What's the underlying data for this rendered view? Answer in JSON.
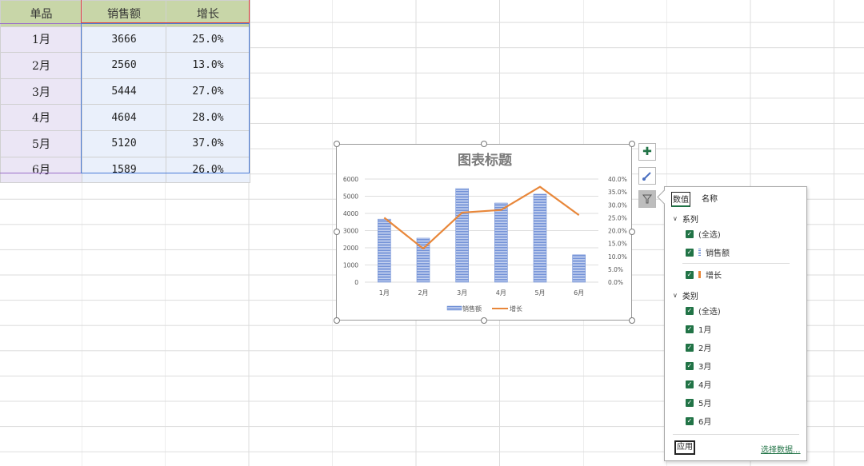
{
  "table": {
    "headers": [
      "单品",
      "销售额",
      "增长"
    ],
    "rows": [
      {
        "month": "1月",
        "sales": "3666",
        "growth": "25.0%"
      },
      {
        "month": "2月",
        "sales": "2560",
        "growth": "13.0%"
      },
      {
        "month": "3月",
        "sales": "5444",
        "growth": "27.0%"
      },
      {
        "month": "4月",
        "sales": "4604",
        "growth": "28.0%"
      },
      {
        "month": "5月",
        "sales": "5120",
        "growth": "37.0%"
      },
      {
        "month": "6月",
        "sales": "1589",
        "growth": "26.0%"
      }
    ]
  },
  "chart_data": {
    "type": "bar",
    "title": "图表标题",
    "categories": [
      "1月",
      "2月",
      "3月",
      "4月",
      "5月",
      "6月"
    ],
    "series": [
      {
        "name": "销售额",
        "type": "bar",
        "axis": "left",
        "values": [
          3666,
          2560,
          5444,
          4604,
          5120,
          1589
        ],
        "color": "#6f8fd6"
      },
      {
        "name": "增长",
        "type": "line",
        "axis": "right",
        "values": [
          0.25,
          0.13,
          0.27,
          0.28,
          0.37,
          0.26
        ],
        "color": "#e8873a"
      }
    ],
    "y_left": {
      "min": 0,
      "max": 6000,
      "ticks": [
        "0",
        "1000",
        "2000",
        "3000",
        "4000",
        "5000",
        "6000"
      ]
    },
    "y_right": {
      "min": 0,
      "max": 0.4,
      "ticks": [
        "0.0%",
        "5.0%",
        "10.0%",
        "15.0%",
        "20.0%",
        "25.0%",
        "30.0%",
        "35.0%",
        "40.0%"
      ]
    },
    "grid": true,
    "legend": "bottom"
  },
  "side_buttons": [
    {
      "name": "chart-elements-button",
      "icon": "plus-icon",
      "glyph": "✚"
    },
    {
      "name": "chart-styles-button",
      "icon": "brush-icon",
      "glyph": "🖌"
    },
    {
      "name": "chart-filters-button",
      "icon": "funnel-icon",
      "glyph": "⏷"
    }
  ],
  "filter_panel": {
    "tabs": [
      "数值",
      "名称"
    ],
    "series_section": "系列",
    "series_items": [
      "(全选)",
      "销售额",
      "增长"
    ],
    "category_section": "类别",
    "category_items": [
      "(全选)",
      "1月",
      "2月",
      "3月",
      "4月",
      "5月",
      "6月"
    ],
    "apply_label": "应用",
    "select_data_label": "选择数据..."
  },
  "colors": {
    "accent": "#217346",
    "bar": "#6f8fd6",
    "line": "#e8873a"
  }
}
